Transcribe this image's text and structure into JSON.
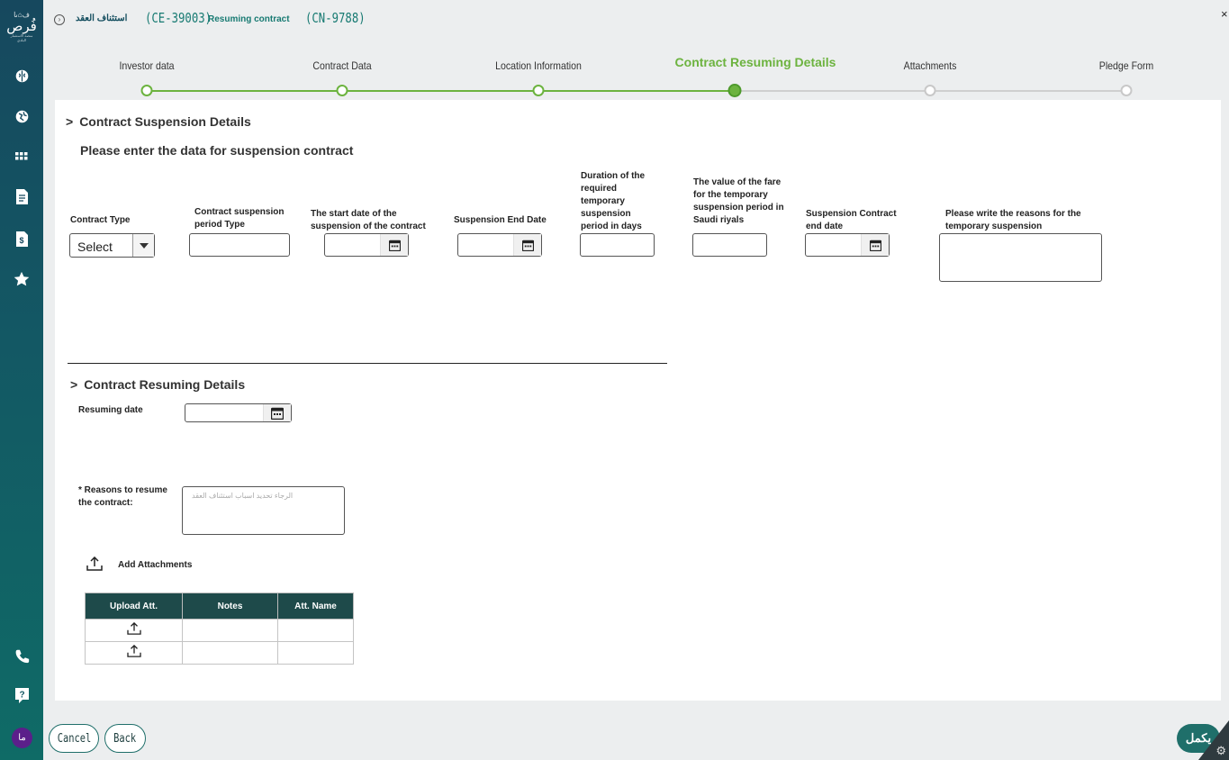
{
  "sidebar": {
    "logo_top": "ف⌂ىا",
    "logo_main": "فُرص",
    "logo_sub": "منصة الاستثمار البلدي",
    "avatar_text": "ما"
  },
  "header": {
    "arabic_title": "استئناف العقد",
    "contract_ce": "(CE-39003)",
    "subtitle": "Resuming contract",
    "contract_cn": "(CN-9788)",
    "close_glyph": "×"
  },
  "steps": [
    {
      "label": "Investor data",
      "state": "done"
    },
    {
      "label": "Contract Data",
      "state": "done"
    },
    {
      "label": "Location Information",
      "state": "done"
    },
    {
      "label": "Contract Resuming Details",
      "state": "current"
    },
    {
      "label": "Attachments",
      "state": "todo"
    },
    {
      "label": "Pledge Form",
      "state": "todo"
    }
  ],
  "suspension": {
    "title": "Contract Suspension Details",
    "subtitle": "Please enter the data for suspension contract",
    "contract_type_label": "Contract Type",
    "contract_type_value": "Select",
    "period_type_label": "Contract suspension period Type",
    "start_date_label": "The start date of the suspension of the contract",
    "end_date_label": "Suspension End Date",
    "duration_label": "Duration of the required temporary suspension period in days",
    "fare_label": "The value of the fare for the temporary suspension period in Saudi riyals",
    "contract_end_label": "Suspension Contract end date",
    "reasons_label": "Please write the reasons for the temporary suspension"
  },
  "resuming": {
    "title": "Contract Resuming Details",
    "date_label": "Resuming date",
    "reasons_label": "* Reasons to resume the contract:",
    "reasons_placeholder": "الرجاء تحديد اسباب استئناف العقد",
    "add_attachments": "Add Attachments"
  },
  "attachments_table": {
    "headers": [
      "Upload Att.",
      "Notes",
      "Att. Name"
    ]
  },
  "footer": {
    "cancel": "Cancel",
    "back": "Back",
    "complete": "يكمل"
  }
}
